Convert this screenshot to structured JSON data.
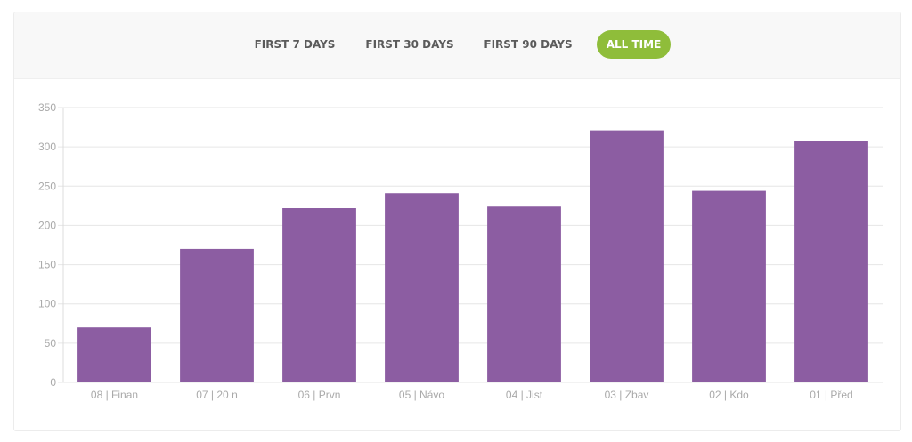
{
  "tabs": [
    {
      "label": "FIRST 7 DAYS",
      "active": false
    },
    {
      "label": "FIRST 30 DAYS",
      "active": false
    },
    {
      "label": "FIRST 90 DAYS",
      "active": false
    },
    {
      "label": "ALL TIME",
      "active": true
    }
  ],
  "colors": {
    "bar": "#8c5da2",
    "active_tab": "#8fbd3a",
    "grid": "#e6e6e6",
    "axis_text": "#a9a9a9"
  },
  "chart_data": {
    "type": "bar",
    "categories": [
      "08 | Finan",
      "07 | 20 n",
      "06 | Prvn",
      "05 | Návo",
      "04 | Jist",
      "03 | Zbav",
      "02 | Kdo",
      "01 | Před"
    ],
    "values": [
      70,
      170,
      222,
      241,
      224,
      321,
      244,
      308
    ],
    "ylim": [
      0,
      350
    ],
    "yticks": [
      0,
      50,
      100,
      150,
      200,
      250,
      300,
      350
    ],
    "grid": true,
    "title": "",
    "xlabel": "",
    "ylabel": ""
  }
}
